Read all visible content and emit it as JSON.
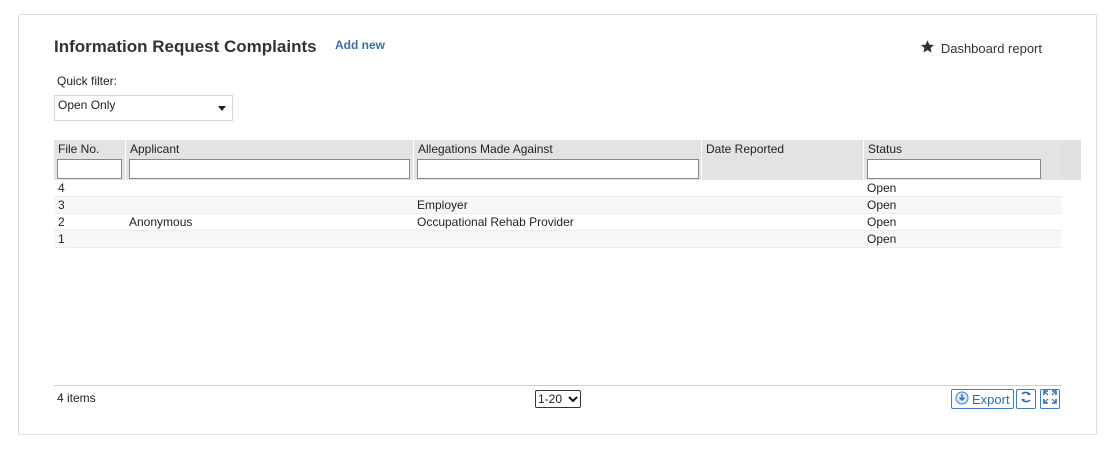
{
  "header": {
    "title": "Information Request Complaints",
    "add_new": "Add new",
    "dashboard_report": "Dashboard report"
  },
  "quick_filter": {
    "label": "Quick filter:",
    "selected": "Open Only"
  },
  "table": {
    "columns": [
      "File No.",
      "Applicant",
      "Allegations Made Against",
      "Date Reported",
      "Status"
    ],
    "rows": [
      {
        "file_no": "4",
        "applicant": "",
        "allegations": "",
        "date_reported": "",
        "status": "Open"
      },
      {
        "file_no": "3",
        "applicant": "",
        "allegations": "Employer",
        "date_reported": "",
        "status": "Open"
      },
      {
        "file_no": "2",
        "applicant": "Anonymous",
        "allegations": "Occupational Rehab Provider",
        "date_reported": "",
        "status": "Open"
      },
      {
        "file_no": "1",
        "applicant": "",
        "allegations": "",
        "date_reported": "",
        "status": "Open"
      }
    ]
  },
  "footer": {
    "item_count": "4 items",
    "page_size": "1-20",
    "export_label": "Export"
  },
  "icons": {
    "dashboard": "star-icon",
    "export": "export-icon",
    "refresh": "refresh-icon",
    "fullscreen": "fullscreen-icon"
  },
  "colors": {
    "accent": "#3a6ea5",
    "header_bg": "#e3e3e3",
    "button_border": "#3a7ec4"
  }
}
